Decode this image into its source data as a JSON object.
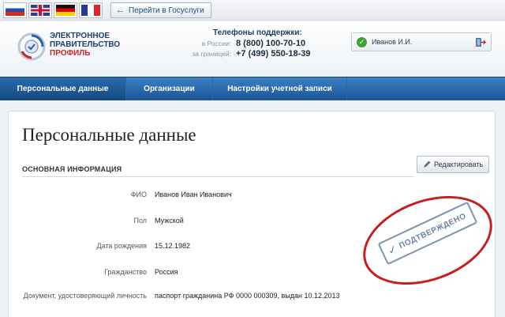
{
  "top": {
    "goto_button": "Перейти в Госуслуги",
    "flags": [
      "ru",
      "uk",
      "de",
      "fr"
    ]
  },
  "header": {
    "logo_line1": "ЭЛЕКТРОННОЕ",
    "logo_line2": "ПРАВИТЕЛЬСТВО",
    "logo_line3": "ПРОФИЛЬ",
    "support_title": "Телефоны поддержки:",
    "phone_russia_label": "в России:",
    "phone_russia": "8 (800) 100-70-10",
    "phone_abroad_label": "за границей:",
    "phone_abroad": "+7 (499) 550-18-39",
    "user_name": "Иванов И.И."
  },
  "nav": {
    "items": [
      "Персональные данные",
      "Организации",
      "Настройки учетной записи"
    ],
    "active": 0
  },
  "main": {
    "page_title": "Персональные данные",
    "section_title": "ОСНОВНАЯ ИНФОРМАЦИЯ",
    "edit_button": "Редактировать",
    "fields": [
      {
        "label": "ФИО",
        "value": "Иванов Иван Иванович"
      },
      {
        "label": "Пол",
        "value": "Мужской"
      },
      {
        "label": "Дата рождения",
        "value": "15.12.1982"
      },
      {
        "label": "Гражданство",
        "value": "Россия"
      },
      {
        "label": "Документ, удостоверяющий личность",
        "value": "паспорт гражданина РФ 0000 000309, выдан 10.12.2013"
      }
    ],
    "stamp_text": "ПОДТВЕРЖДЕНО"
  },
  "colors": {
    "nav_blue": "#1b5597",
    "stamp_red": "#c91d1d",
    "confirmed_green": "#3fa132"
  }
}
